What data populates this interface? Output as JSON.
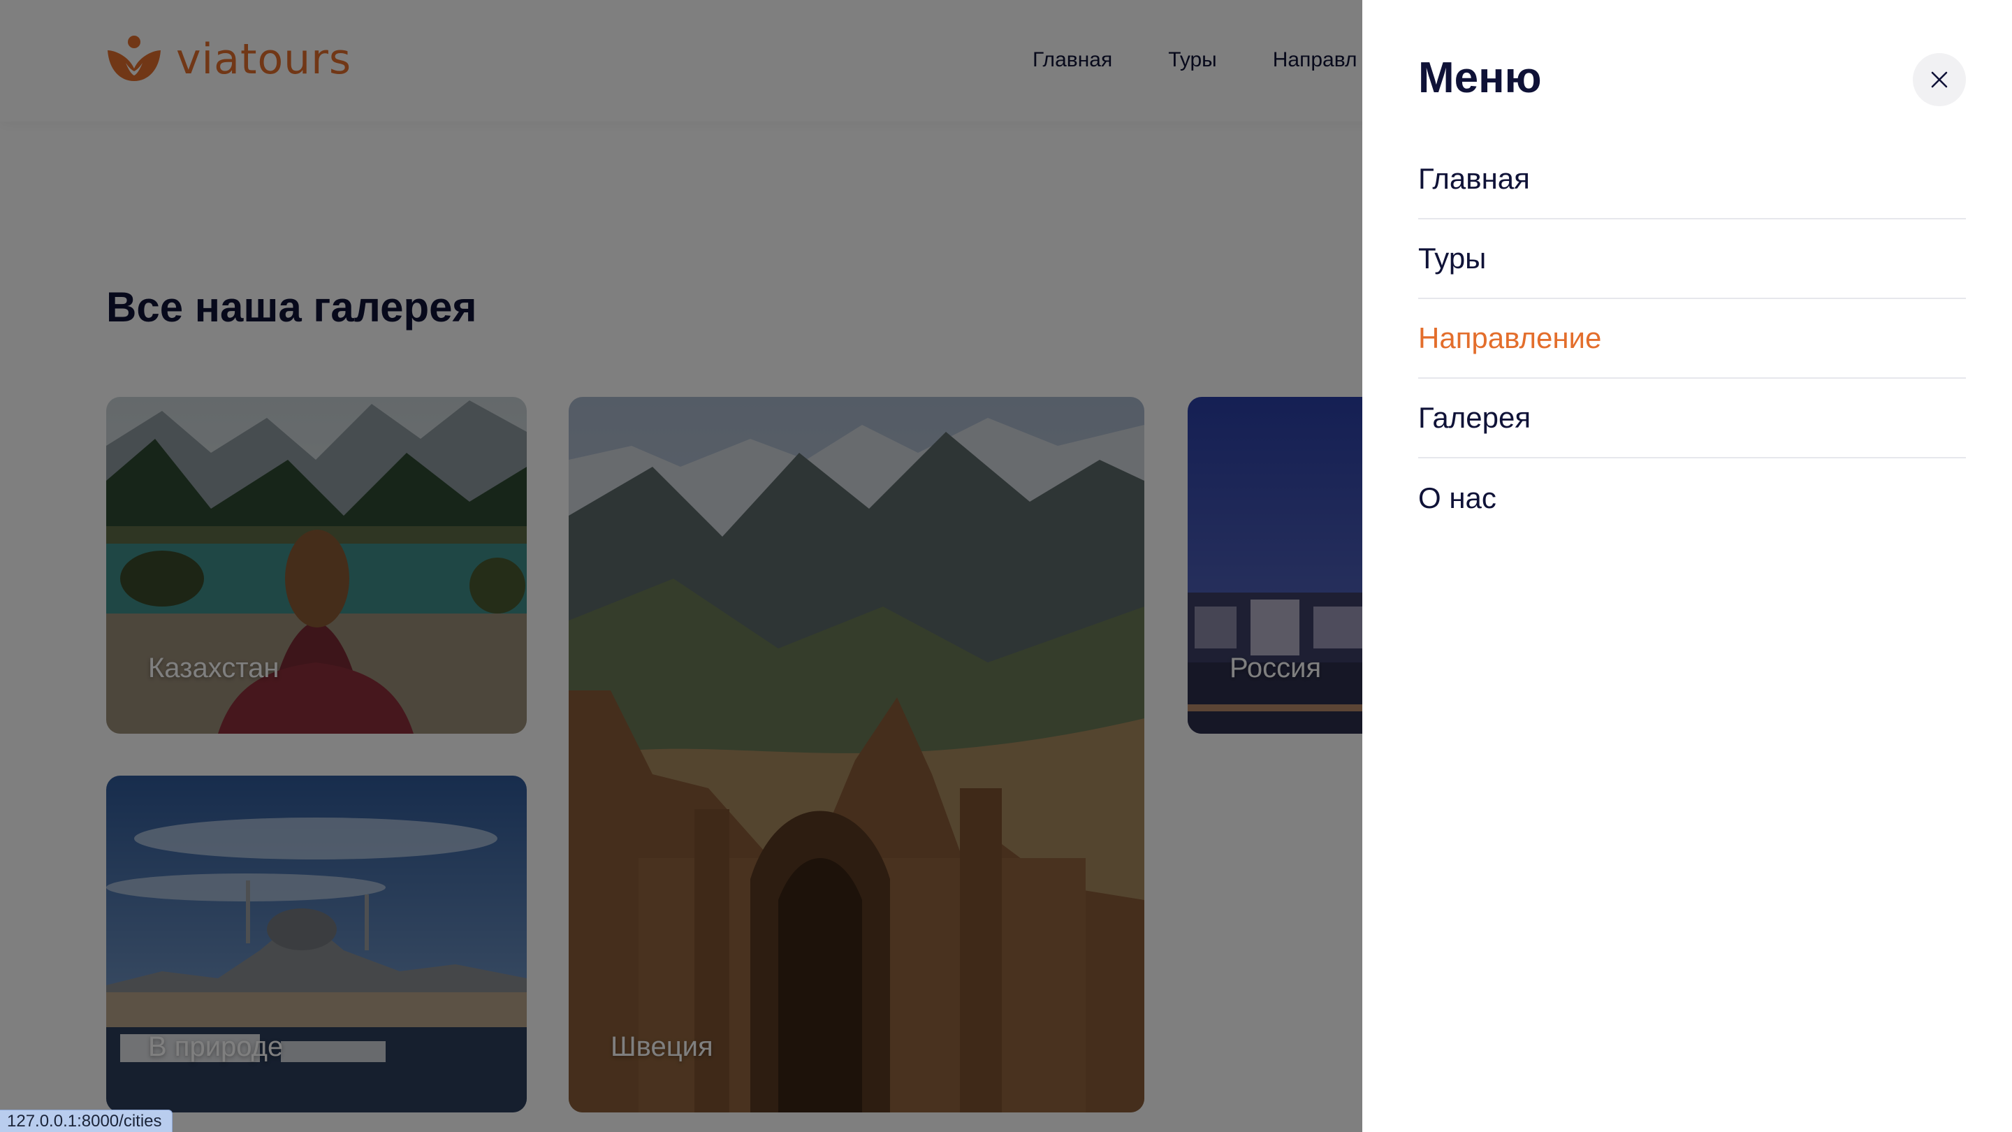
{
  "brand": {
    "name": "viatours",
    "color": "#e36e2c"
  },
  "header": {
    "nav": [
      {
        "label": "Главная"
      },
      {
        "label": "Туры"
      },
      {
        "label": "Направл"
      }
    ]
  },
  "gallery": {
    "title": "Все наша галерея",
    "cards": [
      {
        "label": "Казахстан"
      },
      {
        "label": "Швеция"
      },
      {
        "label": "Россия"
      },
      {
        "label": "В природе"
      }
    ]
  },
  "menu": {
    "title": "Меню",
    "close_icon": "close-icon",
    "items": [
      {
        "label": "Главная",
        "active": false
      },
      {
        "label": "Туры",
        "active": false
      },
      {
        "label": "Направление",
        "active": true
      },
      {
        "label": "Галерея",
        "active": false
      },
      {
        "label": "О нас",
        "active": false
      }
    ],
    "active_color": "#e36e2c"
  },
  "status_bar": {
    "url": "127.0.0.1:8000/cities"
  }
}
